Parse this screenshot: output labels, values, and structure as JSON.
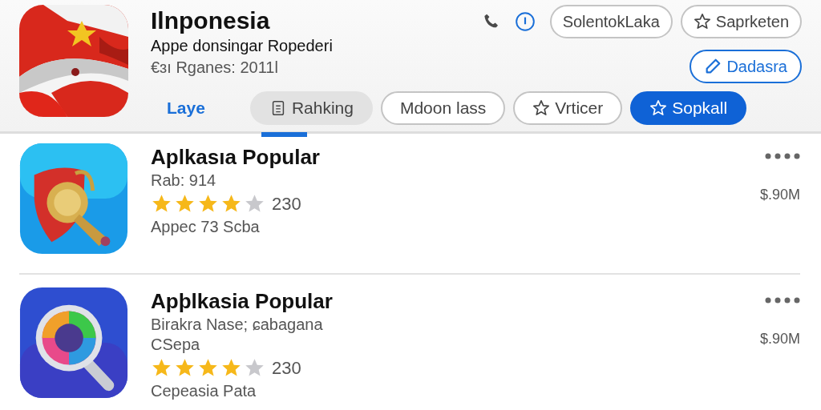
{
  "app": {
    "title": "Ilnponesia",
    "subtitle": "Appe donsingar Ropederi",
    "meta": "€ɜı Rganes: 2011l"
  },
  "header_buttons": [
    {
      "label": "SolentokLaka"
    },
    {
      "label": "Saprketen"
    }
  ],
  "edit_button": {
    "label": "Dadasra"
  },
  "tabs": [
    {
      "label": "Laye",
      "kind": "link",
      "selected": false
    },
    {
      "label": "Rahking",
      "kind": "pill",
      "selected": true
    },
    {
      "label": "Mdoon lass",
      "kind": "pill",
      "selected": false
    },
    {
      "label": "Vrticer",
      "kind": "pill",
      "selected": false
    },
    {
      "label": "Sopkall",
      "kind": "primary",
      "selected": false
    }
  ],
  "apps": [
    {
      "title": "Aplkasıa Popular",
      "lines": [
        "Rab: 914"
      ],
      "stars": 4,
      "rating_count": "230",
      "footer": "Appec 73 Scba",
      "price": "$.90M"
    },
    {
      "title": "Apþlkasia Popular",
      "lines": [
        "Birakra Nase; ɕabagana",
        "CSepa"
      ],
      "stars": 4,
      "rating_count": "230",
      "footer": "Cepeasia Pata",
      "price": "$.90M"
    }
  ]
}
